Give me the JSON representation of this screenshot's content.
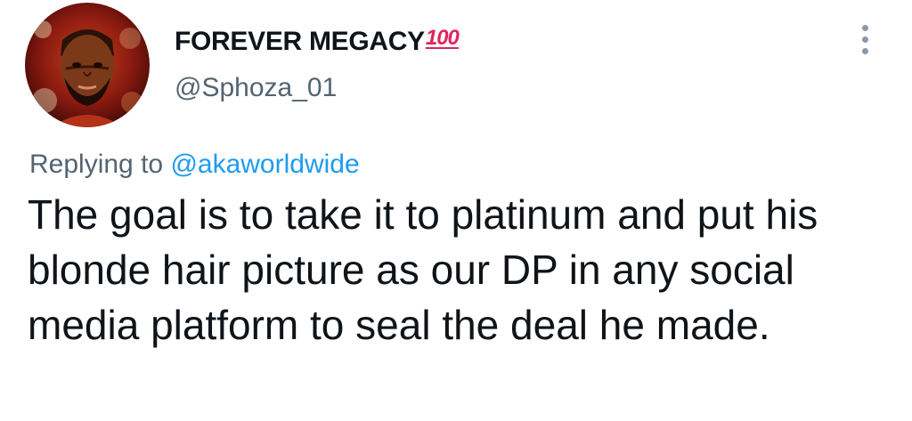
{
  "tweet": {
    "author": {
      "display_name": "FOREVER MEGACY",
      "badge_emoji": "100",
      "handle": "@Sphoza_01",
      "avatar_icon": "user-avatar"
    },
    "reply_context": {
      "prefix": "Replying to ",
      "mention": "@akaworldwide"
    },
    "text": "The goal is to take it to platinum and put his blonde hair picture as our DP in any social media platform to seal the deal he made.",
    "more_icon": "more-options-icon",
    "colors": {
      "mention": "#1d9bf0",
      "secondary_text": "#536471",
      "primary_text": "#0f1419",
      "emoji_red": "#e0245e"
    }
  }
}
